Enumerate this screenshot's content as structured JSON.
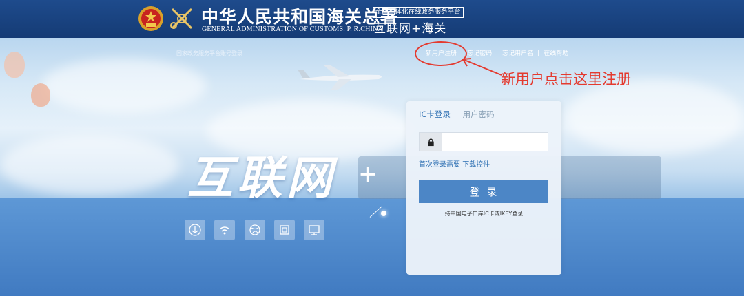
{
  "header": {
    "title_cn": "中华人民共和国海关总署",
    "title_en": "GENERAL ADMINISTRATION OF CUSTOMS. P. R.CHINA",
    "platform_label": "全国一体化在线政务服务平台",
    "platform_name": "互联网+海关"
  },
  "topbar": {
    "tagline": "国家政务服务平台账号登录",
    "links": [
      "新用户注册",
      "忘记密码",
      "忘记用户名",
      "在线帮助"
    ]
  },
  "annotation": {
    "text": "新用户点击这里注册",
    "color": "#e43a2f"
  },
  "hero": {
    "brand": "互联网",
    "plus": "+",
    "icons": [
      "anchor-icon",
      "wifi-icon",
      "globe-icon",
      "window-icon",
      "monitor-icon"
    ]
  },
  "login": {
    "tabs": [
      "IC卡登录",
      "用户密码"
    ],
    "active_tab": "IC卡登录",
    "password_placeholder": "",
    "first_login_prefix": "首次登录需要",
    "download_link": "下载控件",
    "button_label": "登录",
    "ic_note": "持中国电子口岸IC卡或IKEY登录"
  },
  "colors": {
    "header_bg": "#1e4b8c",
    "accent": "#2c6fb2",
    "button": "#4c86c6",
    "annotation": "#e43a2f"
  }
}
